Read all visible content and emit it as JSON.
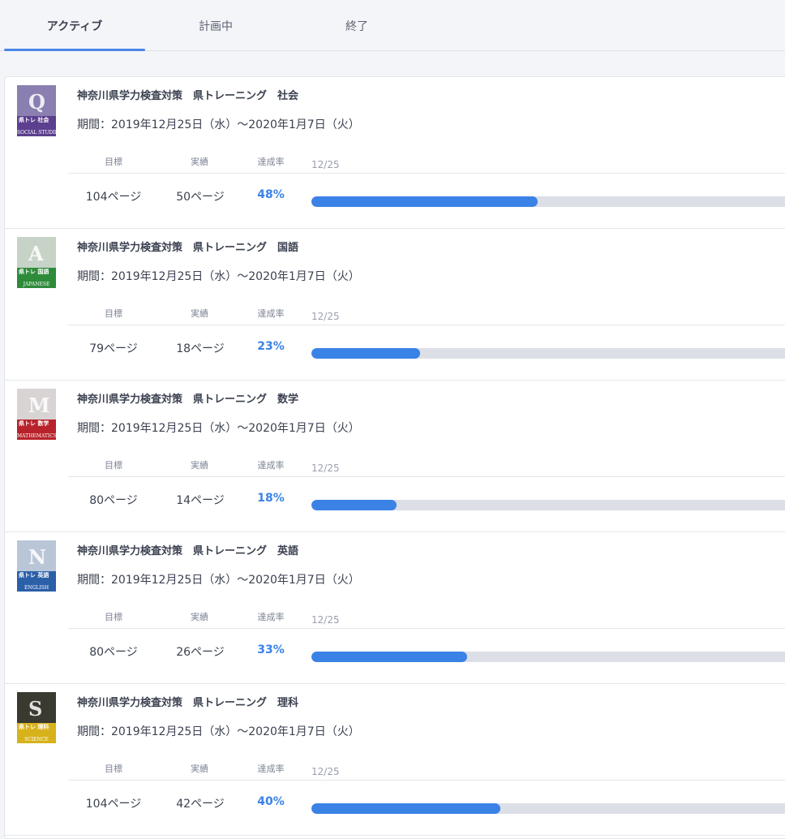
{
  "tabs": [
    {
      "label": "アクティブ",
      "active": true
    },
    {
      "label": "計画中",
      "active": false
    },
    {
      "label": "終了",
      "active": false
    }
  ],
  "colors": {
    "accent": "#3b82e6",
    "track": "#dcdfe6"
  },
  "labels": {
    "target": "目標",
    "actual": "実績",
    "rate": "達成率"
  },
  "plans": [
    {
      "title": "神奈川県学力検査対策　県トレーニング　社会",
      "period": "期間：2019年12月25日（水）〜2020年1月7日（火）",
      "target": "104ページ",
      "actual": "50ページ",
      "rate": "48%",
      "progress": 0.48,
      "date": "12/25",
      "cover": {
        "color": "#5c3f8e",
        "top": "#8a7fb0",
        "letter": "Q",
        "brand": "県トレ 社会",
        "eng": "SOCIAL STUDIES"
      }
    },
    {
      "title": "神奈川県学力検査対策　県トレーニング　国語",
      "period": "期間：2019年12月25日（水）〜2020年1月7日（火）",
      "target": "79ページ",
      "actual": "18ページ",
      "rate": "23%",
      "progress": 0.23,
      "date": "12/25",
      "cover": {
        "color": "#2e8b3a",
        "top": "#c7d3c6",
        "letter": "A",
        "brand": "県トレ 国語",
        "eng": "JAPANESE"
      }
    },
    {
      "title": "神奈川県学力検査対策　県トレーニング　数学",
      "period": "期間：2019年12月25日（水）〜2020年1月7日（火）",
      "target": "80ページ",
      "actual": "14ページ",
      "rate": "18%",
      "progress": 0.18,
      "date": "12/25",
      "cover": {
        "color": "#b8222a",
        "top": "#d9d4d4",
        "letter": "M",
        "brand": "県トレ 数学",
        "eng": "MATHEMATICS"
      }
    },
    {
      "title": "神奈川県学力検査対策　県トレーニング　英語",
      "period": "期間：2019年12月25日（水）〜2020年1月7日（火）",
      "target": "80ページ",
      "actual": "26ページ",
      "rate": "33%",
      "progress": 0.33,
      "date": "12/25",
      "cover": {
        "color": "#2b5fa8",
        "top": "#b9c6d8",
        "letter": "N",
        "brand": "県トレ 英語",
        "eng": "ENGLISH"
      }
    },
    {
      "title": "神奈川県学力検査対策　県トレーニング　理科",
      "period": "期間：2019年12月25日（水）〜2020年1月7日（火）",
      "target": "104ページ",
      "actual": "42ページ",
      "rate": "40%",
      "progress": 0.4,
      "date": "12/25",
      "cover": {
        "color": "#d8b21a",
        "top": "#3a3a30",
        "letter": "S",
        "brand": "県トレ 理科",
        "eng": "SCIENCE"
      }
    }
  ]
}
